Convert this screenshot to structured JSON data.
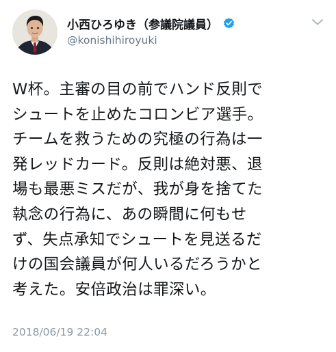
{
  "tweet": {
    "display_name": "小西ひろゆき（参議院議員）",
    "handle": "@konishihiroyuki",
    "verified": true,
    "text": "W杯。主審の目の前でハンド反則で\nシュートを止めたコロンビア選手。\nチームを救うための究極の行為は一\n発レッドカード。反則は絶対悪、退\n場も最悪ミスだが、我が身を捨てた\n執念の行為に、あの瞬間に何もせ\nず、失点承知でシュートを見送るだ\nけの国会議員が何人いるだろうかと\n考えた。安倍政治は罪深い。",
    "timestamp": "2018/06/19 22:04"
  },
  "icons": {
    "avatar": "avatar",
    "verified": "verified-badge-icon",
    "menu": "chevron-down-icon"
  },
  "colors": {
    "name": "#14171a",
    "handle": "#657786",
    "timestamp": "#8899a6",
    "verified": "#1da1f2",
    "chevron": "#aab8c2"
  }
}
